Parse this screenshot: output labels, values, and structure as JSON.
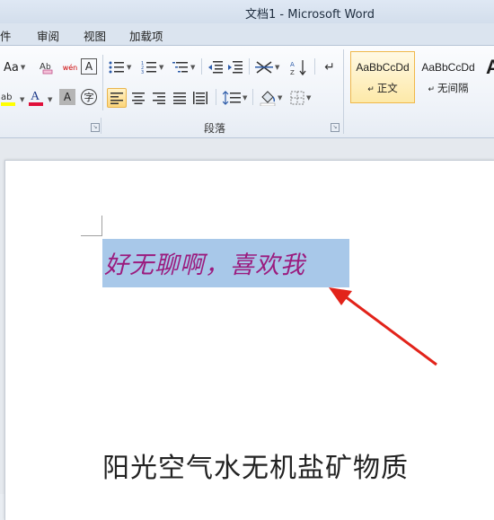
{
  "window": {
    "title": "文档1  -  Microsoft Word"
  },
  "tabs": [
    "件",
    "审阅",
    "视图",
    "加载项"
  ],
  "ribbon": {
    "font_row1": {
      "change_case": "Aa",
      "phonetic": "wén",
      "enclose": "A"
    },
    "font_row2": {
      "font_color": "A",
      "char_shading": "A",
      "enclose_char": "字"
    },
    "paragraph_label": "段落",
    "styles": [
      {
        "sample": "AaBbCcDd",
        "name": "正文",
        "selected": true
      },
      {
        "sample": "AaBbCcDd",
        "name": "无间隔",
        "selected": false
      },
      {
        "sample": "A",
        "name": "",
        "selected": false
      }
    ]
  },
  "document": {
    "selected_text": "好无聊啊，喜欢我",
    "body_text": "阳光空气水无机盐矿物质"
  },
  "colors": {
    "highlight": "#a8c8e9",
    "text_purple": "#9b1b7e",
    "arrow": "#e2231a",
    "style_selected": "#f0b84a"
  }
}
